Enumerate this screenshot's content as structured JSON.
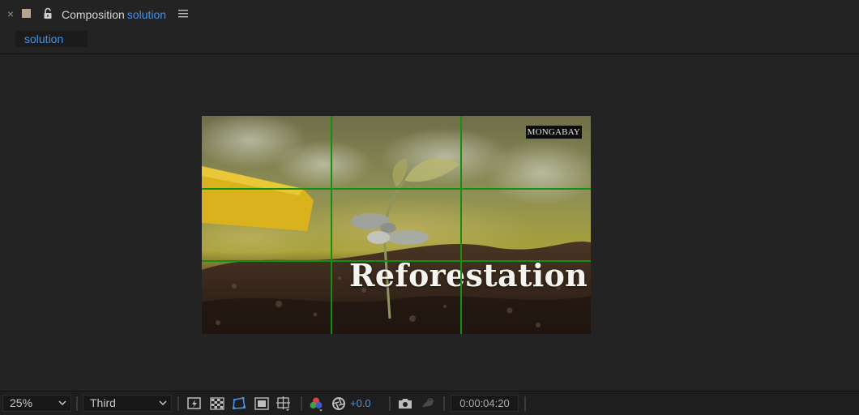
{
  "panel": {
    "close_glyph": "×",
    "label_color": "#b8a68c",
    "title_prefix": "Composition",
    "composition_name": "solution",
    "menu_icon": "hamburger-menu-icon",
    "lock_icon": "lock-icon"
  },
  "tabs": [
    {
      "label": "solution",
      "active": true
    }
  ],
  "viewer": {
    "frame_title": "Reforestation",
    "watermark": "MONGABAY",
    "grid_overlay": "rule-of-thirds",
    "grid_color": "#119111"
  },
  "toolbar": {
    "zoom": "25%",
    "resolution": "Third",
    "icons": [
      "always-preview-icon",
      "transparency-grid-icon",
      "mask-path-visibility-icon",
      "region-of-interest-icon",
      "grid-guides-icon",
      "show-channel-icon",
      "reset-exposure-icon",
      "snapshot-icon",
      "show-snapshot-icon"
    ],
    "exposure": "+0.0",
    "timecode": "0:00:04:20",
    "accent_color": "#4a90e2"
  }
}
